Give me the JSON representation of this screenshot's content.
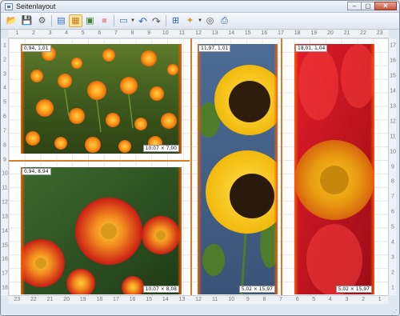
{
  "window": {
    "title": "Seitenlayout",
    "buttons": {
      "minimize": "–",
      "maximize": "▢",
      "close": "✕"
    }
  },
  "toolbar": {
    "items": [
      {
        "name": "open-icon",
        "glyph": "📂"
      },
      {
        "name": "save-icon",
        "glyph": "💾"
      },
      {
        "name": "print-settings-icon",
        "glyph": "⚙"
      },
      {
        "name": "page-setup-icon",
        "glyph": "▤"
      },
      {
        "name": "grid-layout-icon",
        "glyph": "▦"
      },
      {
        "name": "insert-image-icon",
        "glyph": "▣"
      },
      {
        "name": "color-block-icon",
        "glyph": "■"
      },
      {
        "name": "image-options-icon",
        "glyph": "▭"
      },
      {
        "name": "undo-icon",
        "glyph": "↶"
      },
      {
        "name": "redo-icon",
        "glyph": "↷"
      },
      {
        "name": "page-view-icon",
        "glyph": "⊞"
      },
      {
        "name": "effects-icon",
        "glyph": "✦"
      },
      {
        "name": "help-icon",
        "glyph": "◎"
      },
      {
        "name": "print-icon",
        "glyph": "⎙"
      }
    ]
  },
  "rulers": {
    "top": [
      "1",
      "2",
      "3",
      "4",
      "5",
      "6",
      "7",
      "8",
      "9",
      "10",
      "11",
      "12",
      "13",
      "14",
      "15",
      "16",
      "17",
      "18",
      "19",
      "20",
      "21",
      "22",
      "23"
    ],
    "bottom": [
      "23",
      "22",
      "21",
      "20",
      "19",
      "18",
      "17",
      "16",
      "15",
      "14",
      "13",
      "12",
      "11",
      "10",
      "9",
      "8",
      "7",
      "6",
      "5",
      "4",
      "3",
      "2",
      "1"
    ],
    "left": [
      "1",
      "2",
      "3",
      "4",
      "5",
      "6",
      "7",
      "8",
      "9",
      "10",
      "11",
      "12",
      "13",
      "14",
      "15",
      "16",
      "17",
      "18"
    ],
    "right": [
      "17",
      "16",
      "15",
      "14",
      "13",
      "12",
      "11",
      "10",
      "9",
      "8",
      "7",
      "6",
      "5",
      "4",
      "3",
      "2",
      "1"
    ]
  },
  "photos": [
    {
      "name": "photo-marigolds",
      "pos_label": "0,94, 1,01",
      "size_label": "10,07 × 7,00"
    },
    {
      "name": "photo-red-flower",
      "pos_label": "0,94, 8,94",
      "size_label": "10,07 × 8,08"
    },
    {
      "name": "photo-sunflowers",
      "pos_label": "11,97, 1,01",
      "size_label": "5,02 × 15,97"
    },
    {
      "name": "photo-dahlia",
      "pos_label": "18,01, 1,04",
      "size_label": "5,02 × 15,97"
    }
  ]
}
